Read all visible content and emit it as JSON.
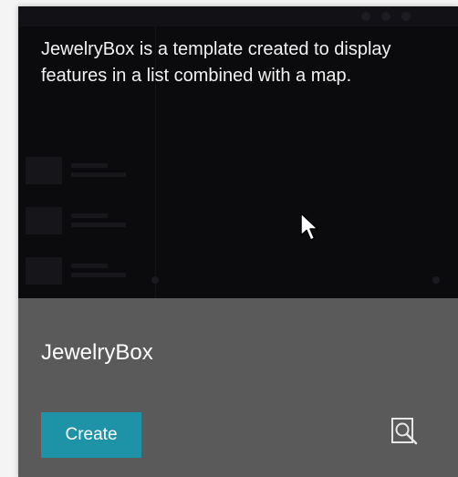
{
  "card": {
    "description": "JewelryBox is a template created to display features in a list combined with a map.",
    "title": "JewelryBox",
    "create_label": "Create",
    "preview_icon": "preview-search-icon",
    "cursor_icon": "mouse-pointer-icon"
  },
  "colors": {
    "thumbnail_bg": "#0b0b0d",
    "footer_bg": "#5a5a5a",
    "accent": "#1e93a7",
    "text": "#ffffff"
  }
}
